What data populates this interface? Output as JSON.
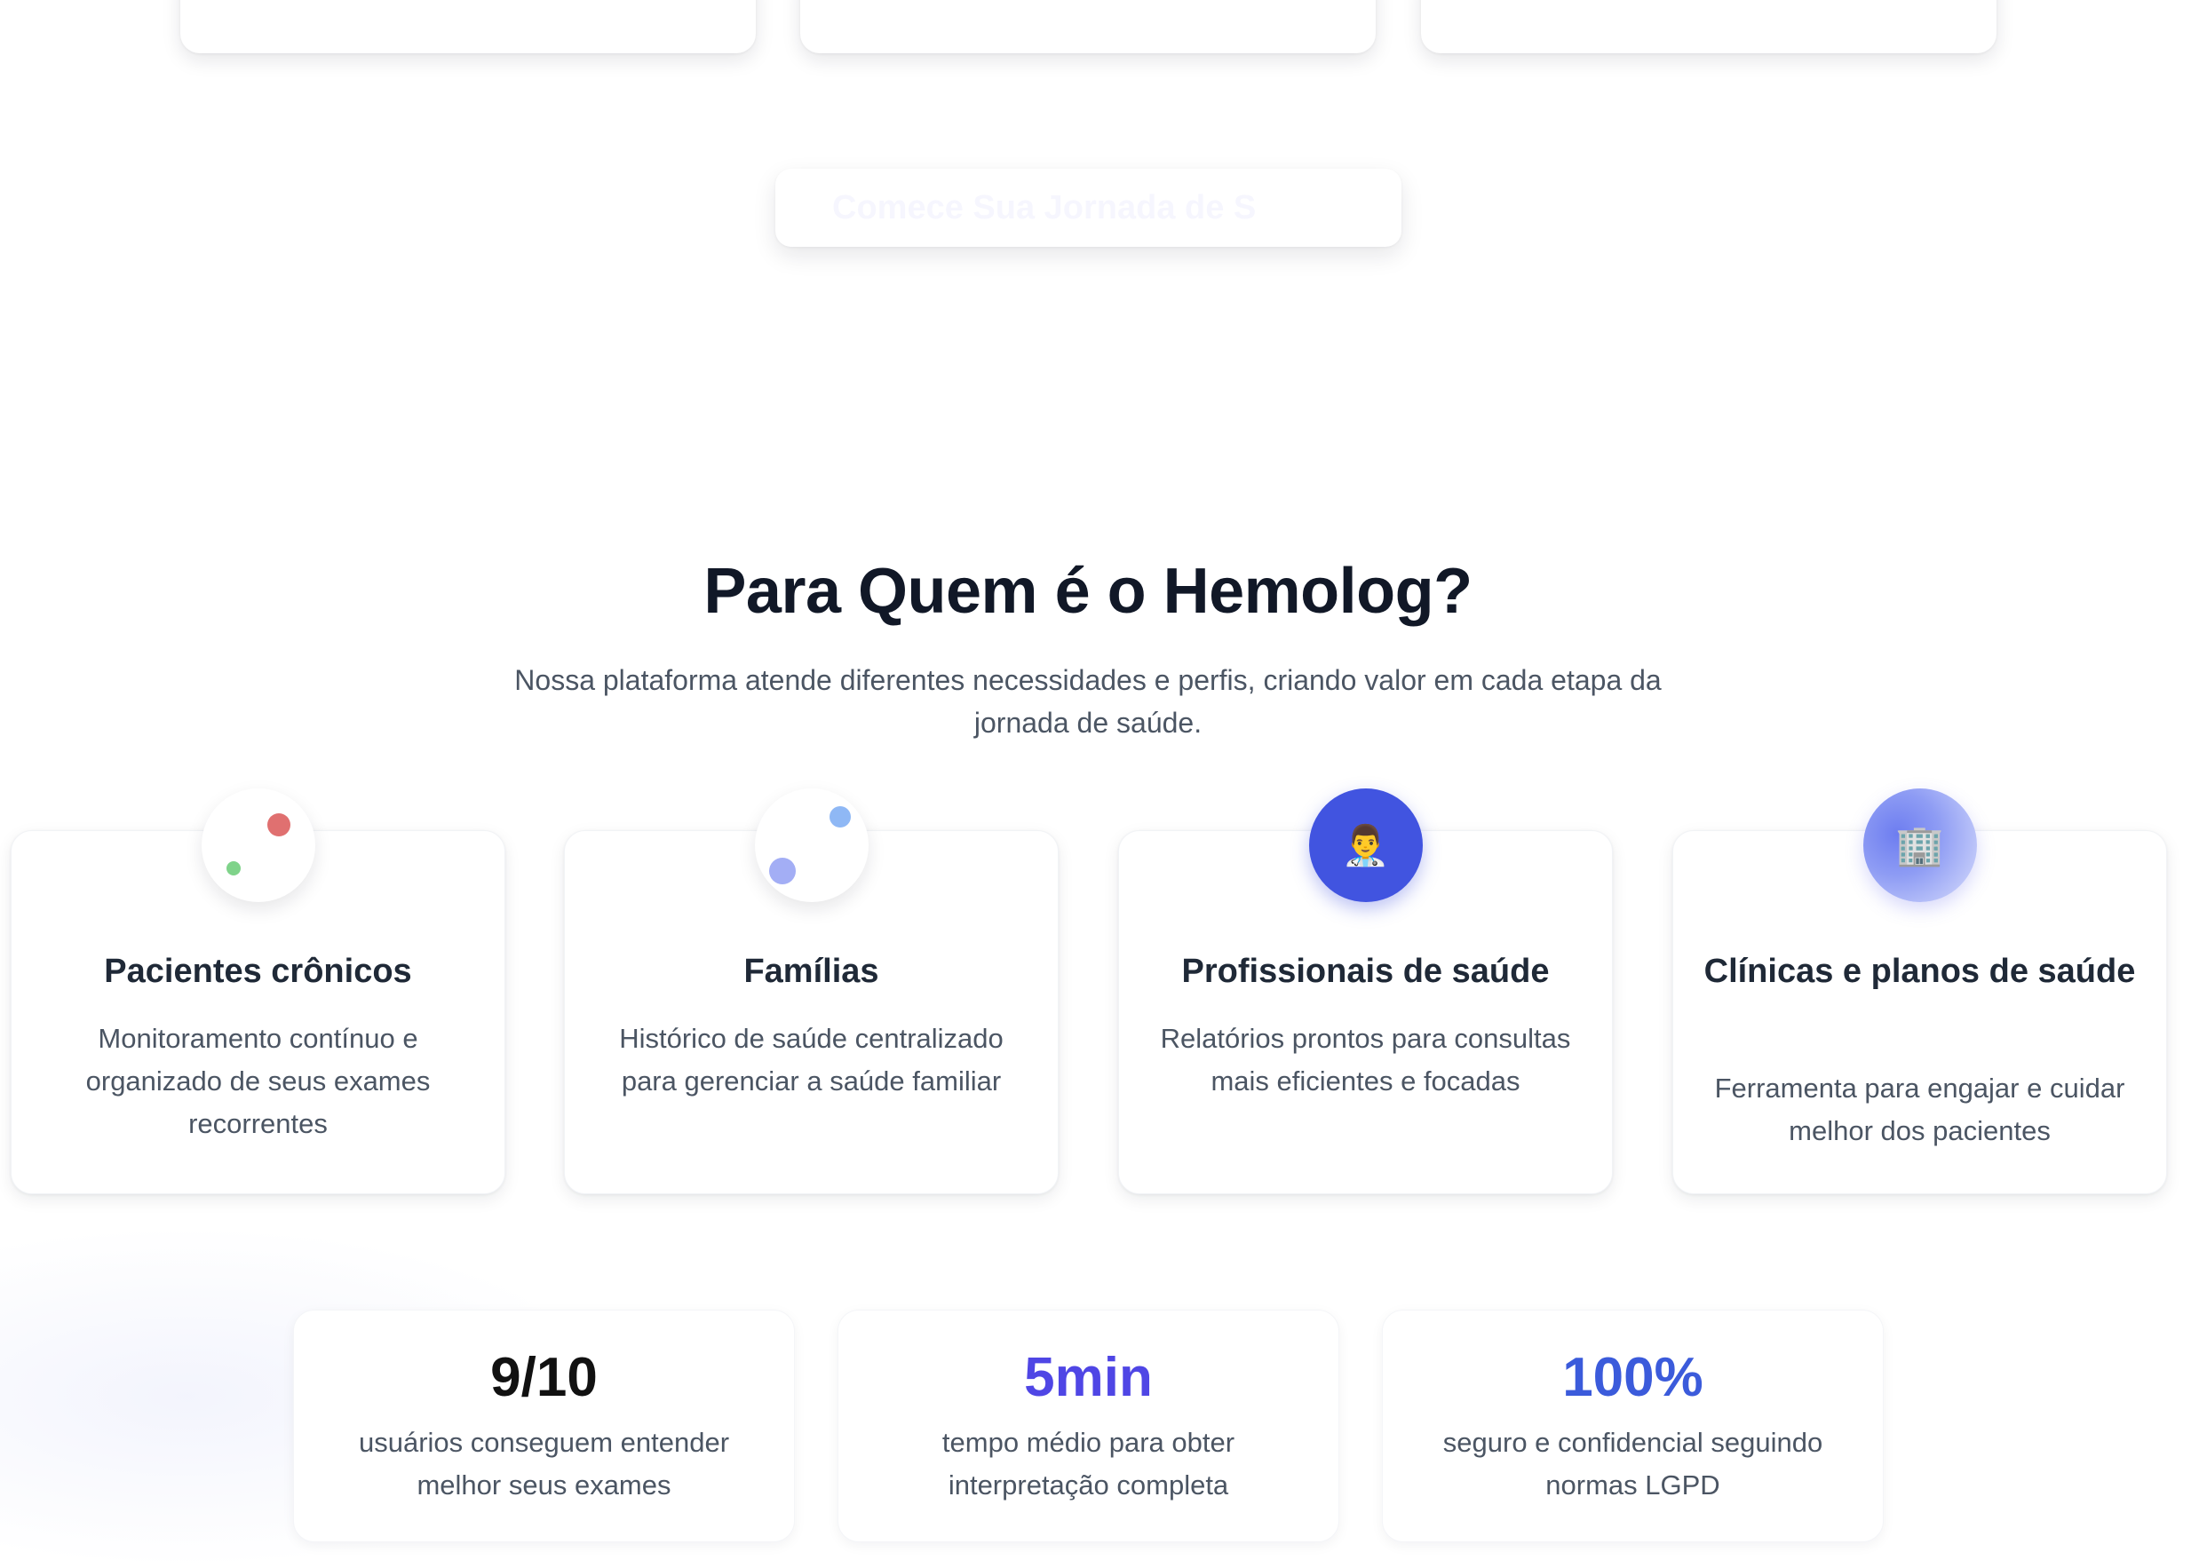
{
  "cta": {
    "label": "Comece Sua Jornada de S"
  },
  "section": {
    "title": "Para Quem é o Hemolog?",
    "subtitle": "Nossa plataforma atende diferentes necessidades e perfis, criando valor em cada etapa da jornada de saúde."
  },
  "audiences": [
    {
      "title": "Pacientes crônicos",
      "description": "Monitoramento contínuo e organizado de seus exames recorrentes"
    },
    {
      "title": "Famílias",
      "description": "Histórico de saúde centralizado para gerenciar a saúde familiar"
    },
    {
      "title": "Profissionais de saúde",
      "description": "Relatórios prontos para consultas mais eficientes e focadas",
      "icon": "👨‍⚕️"
    },
    {
      "title": "Clínicas e planos de saúde",
      "description": "Ferramenta para engajar e cuidar melhor dos pacientes",
      "icon": "🏢"
    }
  ],
  "stats": [
    {
      "value": "9/10",
      "label": "usuários conseguem entender melhor seus exames",
      "color": "#111111"
    },
    {
      "value": "5min",
      "label": "tempo médio para obter interpretação completa",
      "color": "#4f46e5"
    },
    {
      "value": "100%",
      "label": "seguro e confidencial seguindo normas LGPD",
      "color": "#3b5bdb"
    }
  ]
}
